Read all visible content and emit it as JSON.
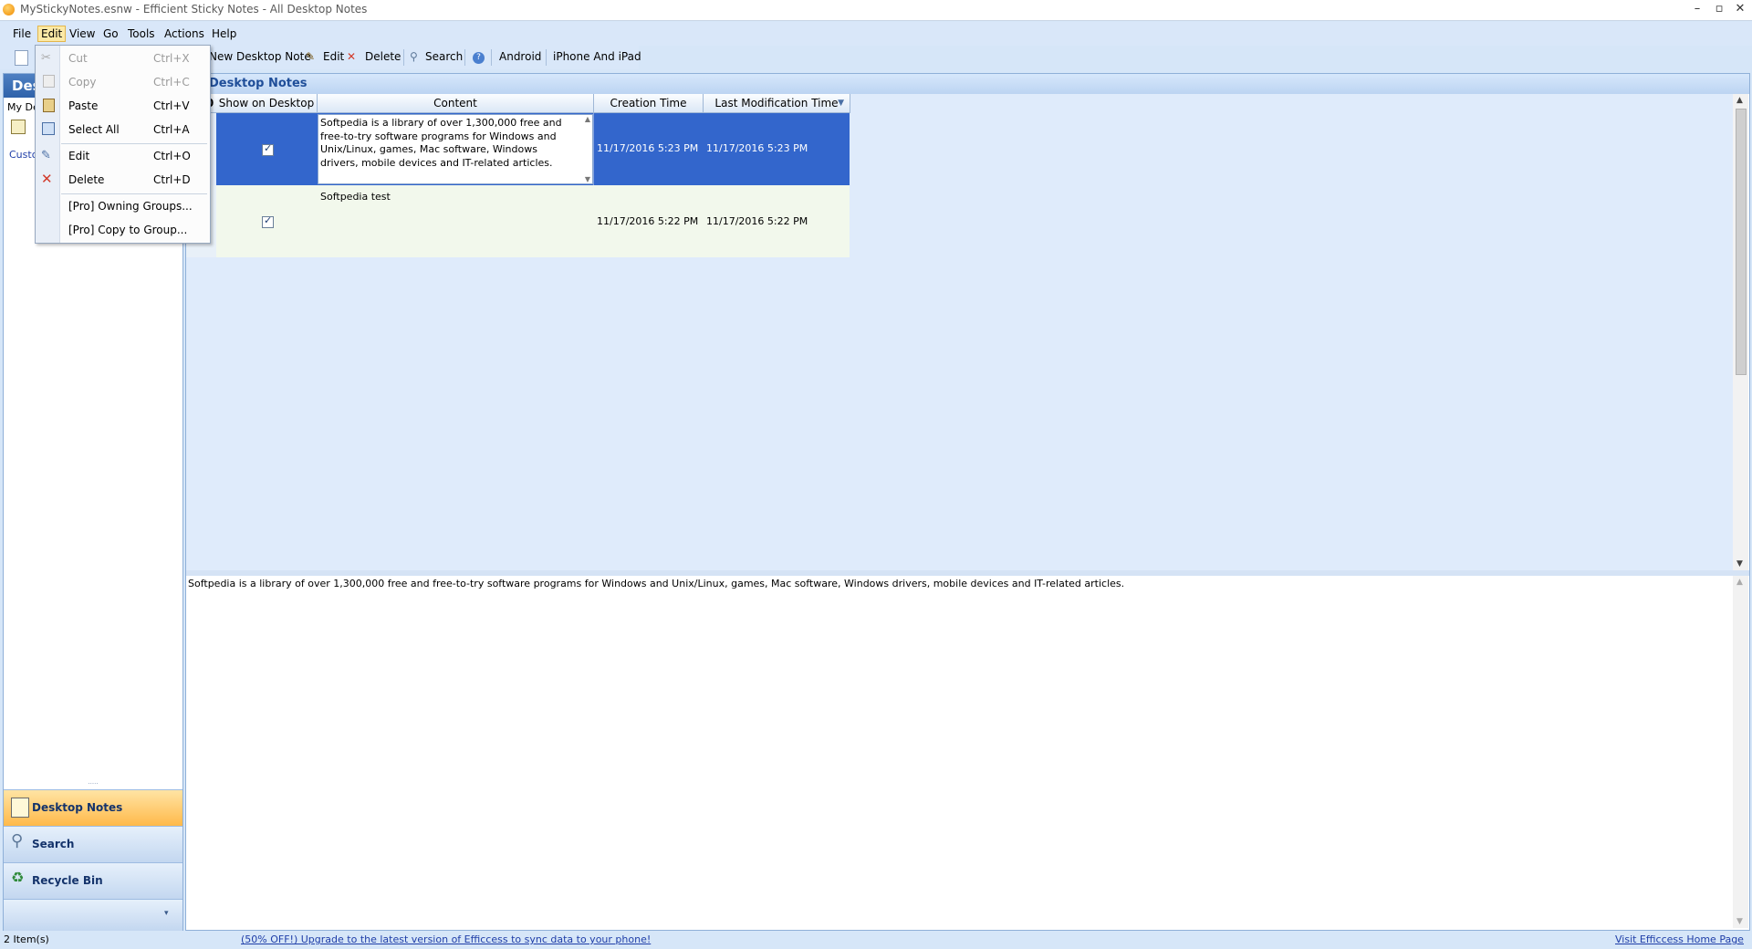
{
  "window": {
    "title": "MyStickyNotes.esnw - Efficient Sticky Notes - All Desktop Notes",
    "controls": [
      "–",
      "▫",
      "✕"
    ]
  },
  "menubar": {
    "items": [
      "File",
      "Edit",
      "View",
      "Go",
      "Tools",
      "Actions",
      "Help"
    ]
  },
  "toolbar": {
    "new_note": "New Desktop Note",
    "edit": "Edit",
    "delete": "Delete",
    "search": "Search",
    "android": "Android",
    "iphone": "iPhone And iPad"
  },
  "edit_menu": {
    "items": [
      {
        "label": "Cut",
        "shortcut": "Ctrl+X",
        "icon": "cut-icon",
        "disabled": true
      },
      {
        "label": "Copy",
        "shortcut": "Ctrl+C",
        "icon": "copy-icon",
        "disabled": true
      },
      {
        "label": "Paste",
        "shortcut": "Ctrl+V",
        "icon": "paste-icon",
        "disabled": false
      },
      {
        "label": "Select All",
        "shortcut": "Ctrl+A",
        "icon": "select-all-icon",
        "disabled": false
      },
      {
        "label": "Edit",
        "shortcut": "Ctrl+O",
        "icon": "edit-icon",
        "disabled": false
      },
      {
        "label": "Delete",
        "shortcut": "Ctrl+D",
        "icon": "delete-icon",
        "disabled": false
      },
      {
        "label": "[Pro] Owning Groups...",
        "shortcut": "",
        "icon": "",
        "disabled": false
      },
      {
        "label": "[Pro] Copy to Group...",
        "shortcut": "",
        "icon": "",
        "disabled": false
      }
    ]
  },
  "left_pane": {
    "header": "Des",
    "my_desktop": "My De",
    "custom": "Custo",
    "nav": [
      {
        "label": "Desktop Notes",
        "icon": "desktop-notes-icon",
        "selected": true
      },
      {
        "label": "Search",
        "icon": "search-icon",
        "selected": false
      },
      {
        "label": "Recycle Bin",
        "icon": "recycle-bin-icon",
        "selected": false
      }
    ]
  },
  "main": {
    "header": "Desktop Notes",
    "columns": [
      "0",
      "Show on Desktop",
      "Content",
      "Creation Time",
      "Last Modification Time"
    ],
    "rows": [
      {
        "show_on_desktop": true,
        "content": "Softpedia is a library of over 1,300,000 free and free-to-try software programs for Windows and Unix/Linux, games, Mac software, Windows drivers, mobile devices and IT-related articles.",
        "creation_time": "11/17/2016 5:23 PM",
        "last_modification_time": "11/17/2016 5:23 PM",
        "selected": true
      },
      {
        "show_on_desktop": true,
        "content": "Softpedia test",
        "creation_time": "11/17/2016 5:22 PM",
        "last_modification_time": "11/17/2016 5:22 PM",
        "selected": false
      }
    ],
    "preview_text": "Softpedia is a library of over 1,300,000 free and free-to-try software programs for Windows and Unix/Linux, games, Mac software, Windows drivers, mobile devices and IT-related articles."
  },
  "statusbar": {
    "count": "2 Item(s)",
    "upgrade": "(50% OFF!) Upgrade to the latest version of Efficcess to sync data to your phone!",
    "homepage": "Visit Efficcess Home Page"
  },
  "colors": {
    "selection": "#3366cc",
    "nav_selected": "#ffb94a",
    "header_blue": "#2f62aa"
  }
}
